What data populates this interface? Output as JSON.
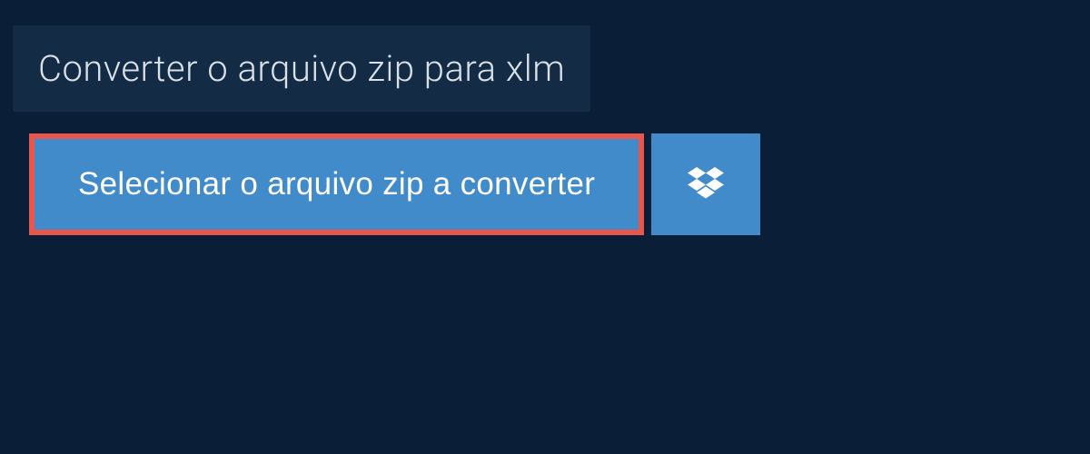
{
  "header": {
    "title": "Converter o arquivo zip para xlm"
  },
  "selectButton": {
    "label": "Selecionar o arquivo zip a converter"
  }
}
